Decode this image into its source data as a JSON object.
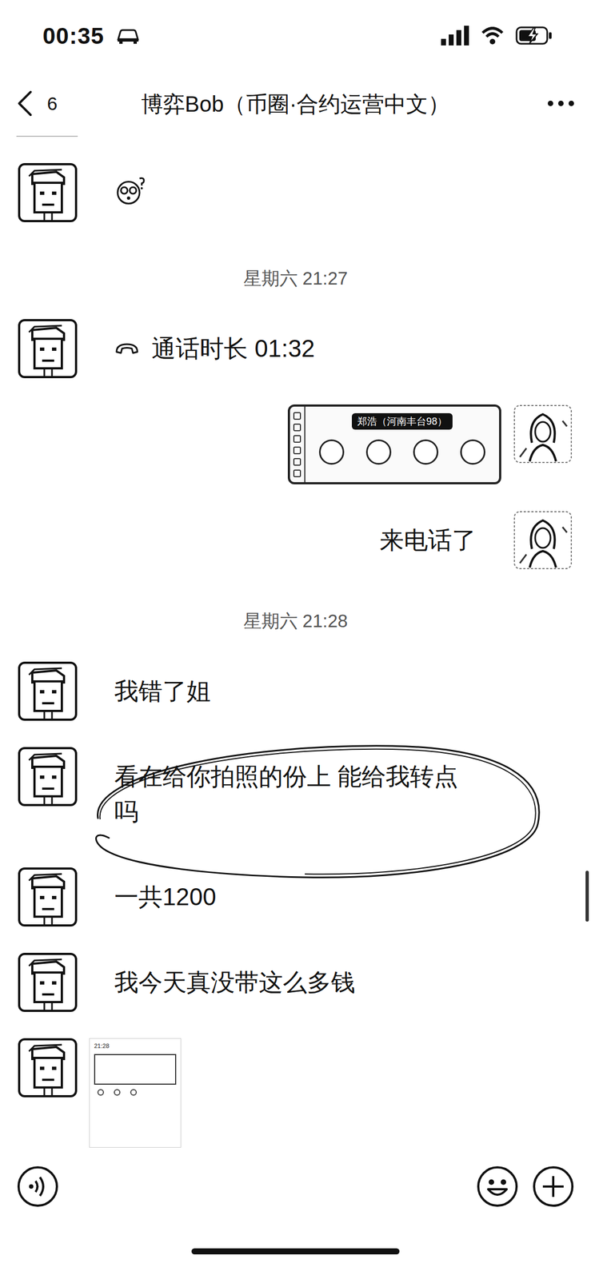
{
  "status_bar": {
    "time": "00:35",
    "charging": true
  },
  "header": {
    "unread": "6",
    "title": "博弈Bob（币圈·合约运营中文）"
  },
  "messages": [
    {
      "kind": "sticker",
      "side": "left",
      "circled": false
    },
    {
      "kind": "time",
      "text": "星期六 21:27"
    },
    {
      "kind": "call",
      "side": "left",
      "text": "通话时长 01:32",
      "circled": false
    },
    {
      "kind": "screenshot",
      "side": "right",
      "caller": "郑浩（河南丰台98）",
      "circled": false
    },
    {
      "kind": "text",
      "side": "right",
      "text": "来电话了",
      "circled": false
    },
    {
      "kind": "time",
      "text": "星期六 21:28"
    },
    {
      "kind": "text",
      "side": "left",
      "text": "我错了姐",
      "circled": false
    },
    {
      "kind": "text",
      "side": "left",
      "text": "看在给你拍照的份上 能给我转点吗",
      "circled": true
    },
    {
      "kind": "text",
      "side": "left",
      "text": "一共1200",
      "circled": false
    },
    {
      "kind": "text",
      "side": "left",
      "text": "我今天真没带这么多钱",
      "circled": false
    },
    {
      "kind": "image",
      "side": "left",
      "time": "21:28",
      "circled": false
    }
  ]
}
